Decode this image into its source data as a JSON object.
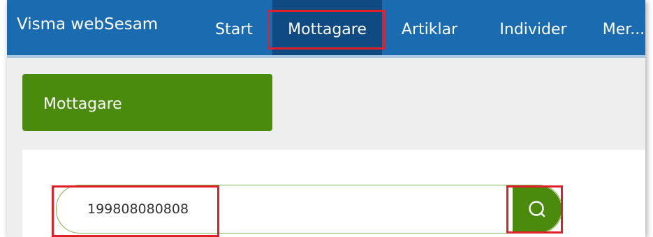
{
  "app": {
    "brand": "Visma webSesam"
  },
  "nav": {
    "items": [
      {
        "label": "Start"
      },
      {
        "label": "Mottagare"
      },
      {
        "label": "Artiklar"
      },
      {
        "label": "Individer"
      },
      {
        "label": "Mer..."
      }
    ],
    "active": "Mottagare"
  },
  "page": {
    "title": "Mottagare"
  },
  "search": {
    "value": "199808080808",
    "icon": "search-icon"
  },
  "colors": {
    "navbar": "#1b6bb0",
    "nav_active": "#0f4b82",
    "accent_green": "#4a8a0c",
    "highlight_red": "#e01f2b",
    "page_background": "#eeeeee"
  }
}
